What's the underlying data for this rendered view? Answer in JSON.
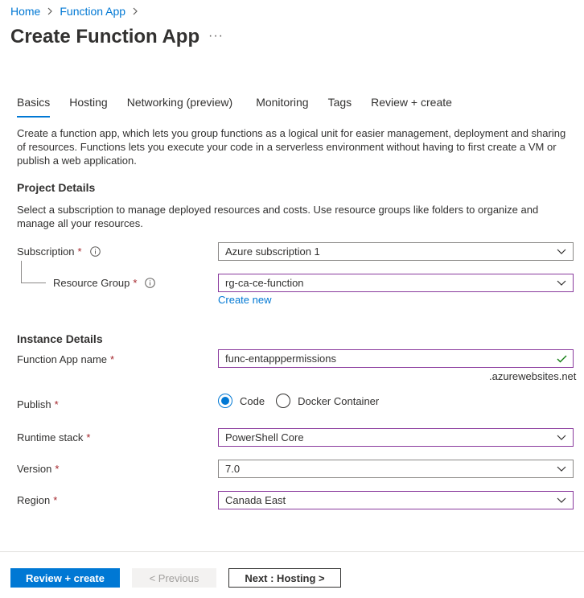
{
  "breadcrumb": {
    "items": [
      "Home",
      "Function App"
    ]
  },
  "page": {
    "title": "Create Function App",
    "more": "···"
  },
  "tabs": [
    "Basics",
    "Hosting",
    "Networking (preview)",
    "Monitoring",
    "Tags",
    "Review + create"
  ],
  "intro": "Create a function app, which lets you group functions as a logical unit for easier management, deployment and sharing of resources. Functions lets you execute your code in a serverless environment without having to first create a VM or publish a web application.",
  "project": {
    "title": "Project Details",
    "description": "Select a subscription to manage deployed resources and costs. Use resource groups like folders to organize and manage all your resources.",
    "subscription_label": "Subscription",
    "subscription_value": "Azure subscription 1",
    "resource_group_label": "Resource Group",
    "resource_group_value": "rg-ca-ce-function",
    "create_new": "Create new"
  },
  "instance": {
    "title": "Instance Details",
    "name_label": "Function App name",
    "name_value": "func-entapppermissions",
    "name_suffix": ".azurewebsites.net",
    "publish_label": "Publish",
    "publish_options": [
      "Code",
      "Docker Container"
    ],
    "publish_selected": "Code",
    "runtime_label": "Runtime stack",
    "runtime_value": "PowerShell Core",
    "version_label": "Version",
    "version_value": "7.0",
    "region_label": "Region",
    "region_value": "Canada East"
  },
  "required_marker": "*",
  "footer": {
    "review": "Review + create",
    "previous": "< Previous",
    "next": "Next : Hosting >"
  },
  "colors": {
    "accent": "#0078d4",
    "focus_border": "#8a3a9d",
    "required": "#a4262c",
    "valid": "#107c10"
  }
}
